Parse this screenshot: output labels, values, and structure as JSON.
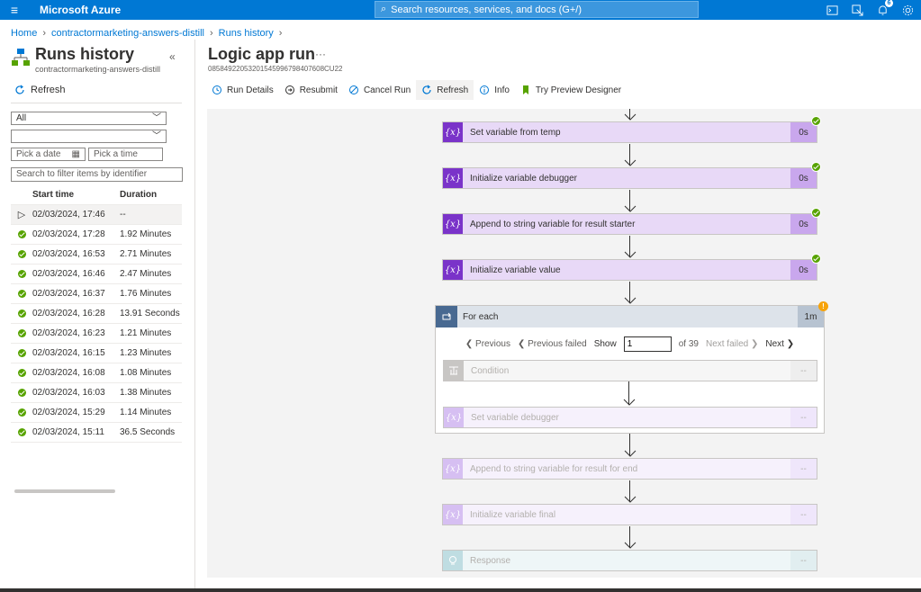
{
  "topbar": {
    "brand": "Microsoft Azure",
    "search_placeholder": "Search resources, services, and docs (G+/)",
    "notification_count": "6",
    "icons": [
      "menu-icon",
      "search-icon",
      "cloud-shell-icon",
      "directory-filter-icon",
      "notifications-icon",
      "settings-icon"
    ]
  },
  "breadcrumb": {
    "home": "Home",
    "app": "contractormarketing-answers-distill",
    "page": "Runs history"
  },
  "runs_panel": {
    "title": "Runs history",
    "subtitle": "contractormarketing-answers-distill",
    "refresh_label": "Refresh",
    "status_filter": "All",
    "second_filter": "",
    "date_placeholder": "Pick a date",
    "time_placeholder": "Pick a time",
    "search_placeholder": "Search to filter items by identifier",
    "columns": [
      "Start time",
      "Duration"
    ],
    "rows": [
      {
        "status": "running",
        "start": "02/03/2024, 17:46",
        "duration": "--"
      },
      {
        "status": "succeeded",
        "start": "02/03/2024, 17:28",
        "duration": "1.92 Minutes"
      },
      {
        "status": "succeeded",
        "start": "02/03/2024, 16:53",
        "duration": "2.71 Minutes"
      },
      {
        "status": "succeeded",
        "start": "02/03/2024, 16:46",
        "duration": "2.47 Minutes"
      },
      {
        "status": "succeeded",
        "start": "02/03/2024, 16:37",
        "duration": "1.76 Minutes"
      },
      {
        "status": "succeeded",
        "start": "02/03/2024, 16:28",
        "duration": "13.91 Seconds"
      },
      {
        "status": "succeeded",
        "start": "02/03/2024, 16:23",
        "duration": "1.21 Minutes"
      },
      {
        "status": "succeeded",
        "start": "02/03/2024, 16:15",
        "duration": "1.23 Minutes"
      },
      {
        "status": "succeeded",
        "start": "02/03/2024, 16:08",
        "duration": "1.08 Minutes"
      },
      {
        "status": "succeeded",
        "start": "02/03/2024, 16:03",
        "duration": "1.38 Minutes"
      },
      {
        "status": "succeeded",
        "start": "02/03/2024, 15:29",
        "duration": "1.14 Minutes"
      },
      {
        "status": "succeeded",
        "start": "02/03/2024, 15:11",
        "duration": "36.5 Seconds"
      }
    ]
  },
  "run": {
    "title": "Logic app run",
    "more": "···",
    "run_id": "08584922053201545996798407608CU22",
    "toolbar": [
      "Run Details",
      "Resubmit",
      "Cancel Run",
      "Refresh",
      "Info",
      "Try Preview Designer"
    ]
  },
  "steps": [
    {
      "label": "Set variable from temp",
      "duration": "0s"
    },
    {
      "label": "Initialize variable debugger",
      "duration": "0s"
    },
    {
      "label": "Append to string variable for result starter",
      "duration": "0s"
    },
    {
      "label": "Initialize variable value",
      "duration": "0s"
    }
  ],
  "foreach": {
    "title": "For each",
    "duration": "1m",
    "previous": "Previous",
    "previous_failed": "Previous failed",
    "show_label": "Show",
    "iteration": "1",
    "of_label": "of 39",
    "next_failed": "Next failed",
    "next": "Next",
    "condition": {
      "label": "Condition",
      "duration": "--"
    },
    "inner_step": {
      "label": "Set variable debugger",
      "duration": "--"
    }
  },
  "pending_steps": [
    {
      "label": "Append to string variable for result for end",
      "duration": "--"
    },
    {
      "label": "Initialize variable final",
      "duration": "--"
    },
    {
      "label": "Response",
      "duration": "--"
    }
  ],
  "colors": {
    "azure_blue": "#0078d4",
    "variable_purple": "#7a33c9",
    "success_green": "#57a300",
    "warning_orange": "#f7a30a",
    "foreach_blue": "#486991"
  }
}
